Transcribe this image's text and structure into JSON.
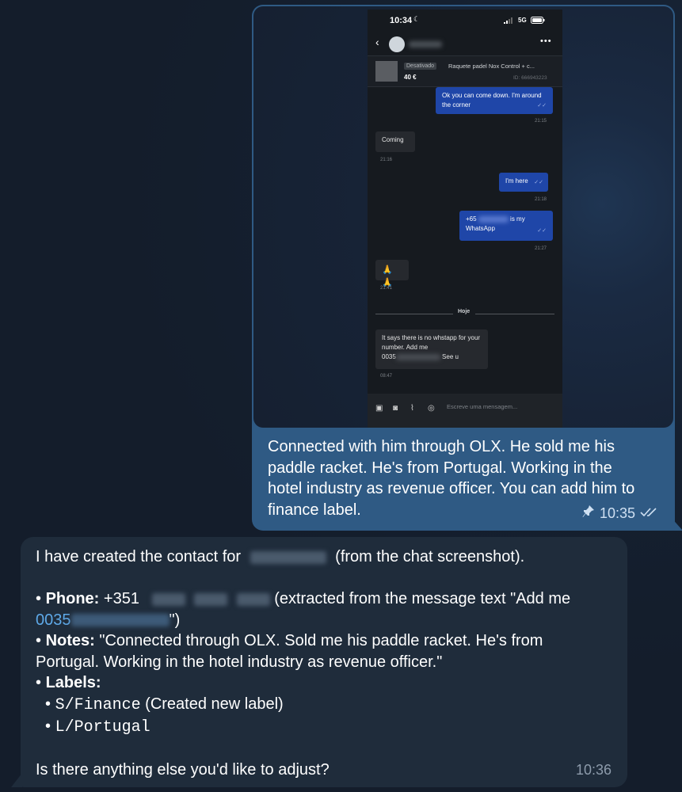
{
  "outgoing": {
    "phone": {
      "status_time": "10:34",
      "network": "5G",
      "ad": {
        "badge": "Desativado",
        "title": "Raquete padel Nox Control + c...",
        "price": "40 €",
        "id": "ID: 666943223"
      },
      "messages": [
        {
          "dir": "out",
          "text": "Ok you can come down. I'm around the corner",
          "time": "21:15"
        },
        {
          "dir": "in",
          "text": "Coming",
          "time": "21:16"
        },
        {
          "dir": "out",
          "text": "I'm here",
          "time": "21:18"
        },
        {
          "dir": "out",
          "text_prefix": "+65",
          "text_suffix": "is my WhatsApp",
          "time": "21:27"
        },
        {
          "dir": "in",
          "text": "🙏🙏",
          "time": "21:41"
        },
        {
          "dir": "in",
          "text": "It says there is no whstapp for your number. Add me",
          "text_line3_prefix": "0035",
          "text_line3_suffix": "See u",
          "time": "08:47"
        }
      ],
      "day_divider": "Hoje",
      "input_placeholder": "Escreve uma mensagem..."
    },
    "caption": "Connected with him through OLX. He sold me his paddle racket. He's from Portugal. Working in the hotel industry as revenue officer. You can add him to finance label.",
    "time": "10:35"
  },
  "incoming": {
    "intro_before": "I have created the contact for",
    "intro_after": "(from the chat screenshot).",
    "phone_label": "Phone:",
    "phone_value": "+351",
    "phone_extracted": "(extracted from the message text \"Add me",
    "phone_link": "0035",
    "phone_close": "\")",
    "notes_label": "Notes:",
    "notes_value": "\"Connected through OLX. Sold me his paddle racket. He's from Portugal. Working in the hotel industry as revenue officer.\"",
    "labels_label": "Labels:",
    "label1": "S/Finance",
    "label1_note": "(Created new label)",
    "label2": "L/Portugal",
    "question": "Is there anything else you'd like to adjust?",
    "time": "10:36"
  }
}
